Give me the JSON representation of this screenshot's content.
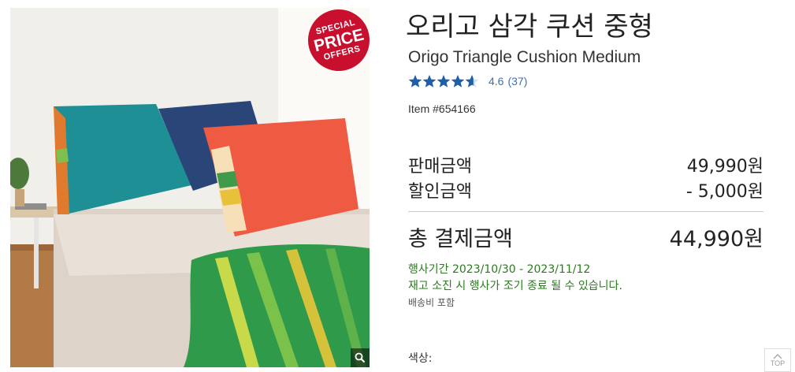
{
  "badge": {
    "line1": "SPECIAL",
    "line2": "PRICE",
    "line3": "OFFERS"
  },
  "product": {
    "title_ko": "오리고 삼각 쿠션 중형",
    "title_en": "Origo Triangle Cushion Medium",
    "rating_value": "4.6",
    "rating_count": "(37)",
    "rating_stars": 4.6,
    "item_number": "Item #654166"
  },
  "pricing": {
    "sale_label": "판매금액",
    "sale_value": "49,990원",
    "discount_label": "할인금액",
    "discount_value": "- 5,000원",
    "total_label": "총 결제금액",
    "total_value": "44,990원"
  },
  "promo": {
    "event_period": "행사기간 2023/10/30 - 2023/11/12",
    "stock_notice": "재고 소진 시 행사가 조기 종료 될 수 있습니다.",
    "shipping": "배송비 포함"
  },
  "options": {
    "color_label": "색상:"
  },
  "top_button": {
    "label": "TOP"
  },
  "colors": {
    "star": "#1f5fa8",
    "badge": "#c8102e",
    "promo_text": "#2a7a1e",
    "link": "#3970b8"
  }
}
